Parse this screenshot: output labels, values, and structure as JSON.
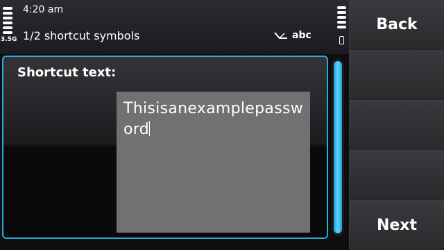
{
  "status": {
    "time": "4:20 am",
    "network": "3.5G",
    "subtitle": "1/2 shortcut symbols",
    "input_mode": "abc",
    "icons": [
      "signal-icon",
      "battery-icon",
      "pen-input-icon"
    ]
  },
  "form": {
    "label": "Shortcut text:",
    "value": "Thisisanexamplepassword"
  },
  "softkeys": {
    "top": "Back",
    "bottom": "Next"
  },
  "colors": {
    "accent": "#2aa8e0",
    "input_bg": "#737074"
  }
}
